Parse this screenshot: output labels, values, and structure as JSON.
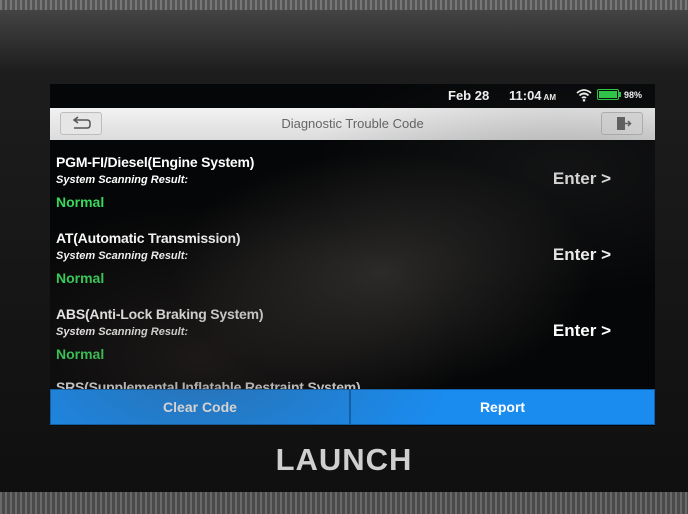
{
  "status": {
    "date": "Feb 28",
    "time": "11:04",
    "ampm": "AM",
    "battery_pct": "98%",
    "battery_level": 0.98
  },
  "header": {
    "title": "Diagnostic Trouble Code",
    "back_icon": "back-arrow-icon",
    "exit_icon": "exit-icon"
  },
  "systems": [
    {
      "name": "PGM-FI/Diesel(Engine System)",
      "label": "System Scanning Result:",
      "status": "Normal",
      "action": "Enter >"
    },
    {
      "name": "AT(Automatic Transmission)",
      "label": "System Scanning Result:",
      "status": "Normal",
      "action": "Enter >"
    },
    {
      "name": "ABS(Anti-Lock Braking System)",
      "label": "System Scanning Result:",
      "status": "Normal",
      "action": "Enter >"
    },
    {
      "name": "SRS(Supplemental Inflatable Restraint System)",
      "label": "",
      "status": "",
      "action": ""
    }
  ],
  "buttons": {
    "clear_code": "Clear Code",
    "report": "Report"
  },
  "brand": "LAUNCH",
  "colors": {
    "accent": "#1a8cf0",
    "status_ok": "#39d75a",
    "battery": "#2fd34a"
  }
}
